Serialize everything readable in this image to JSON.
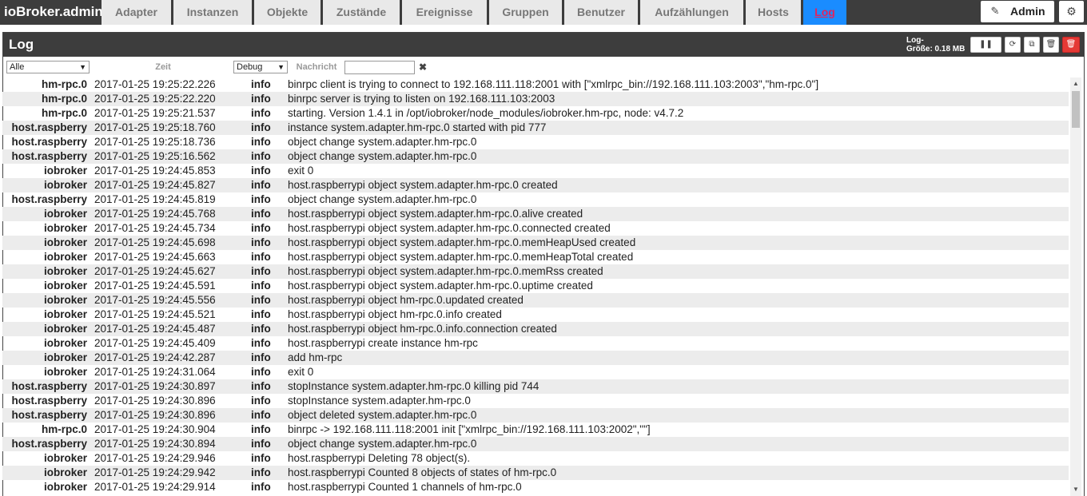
{
  "app": {
    "brand": "ioBroker.admin"
  },
  "nav": {
    "tabs": [
      {
        "label": "Adapter",
        "active": false
      },
      {
        "label": "Instanzen",
        "active": false
      },
      {
        "label": "Objekte",
        "active": false
      },
      {
        "label": "Zustände",
        "active": false
      },
      {
        "label": "Ereignisse",
        "active": false
      },
      {
        "label": "Gruppen",
        "active": false
      },
      {
        "label": "Benutzer",
        "active": false
      },
      {
        "label": "Aufzählungen",
        "active": false
      },
      {
        "label": "Hosts",
        "active": false
      },
      {
        "label": "Log",
        "active": true
      }
    ],
    "admin_label": "Admin",
    "admin_icon": "pencil-icon",
    "settings_icon": "gear-icon"
  },
  "panel": {
    "title": "Log",
    "logsize_label": "Log-",
    "logsize_value": "Größe: 0.18 MB",
    "buttons": [
      {
        "icon": "pause-icon",
        "glyph": "❚❚"
      },
      {
        "icon": "refresh-icon",
        "glyph": "⟳"
      },
      {
        "icon": "copy-icon",
        "glyph": "⧉"
      },
      {
        "icon": "clear-icon",
        "glyph": "🗑"
      },
      {
        "icon": "delete-icon",
        "glyph": "🗑"
      }
    ]
  },
  "filters": {
    "source_value": "Alle",
    "time_label": "Zeit",
    "level_value": "Debug",
    "message_label": "Nachricht",
    "message_value": "",
    "clear_glyph": "✖"
  },
  "log": {
    "rows": [
      {
        "src": "hm-rpc.0",
        "time": "2017-01-25 19:25:22.226",
        "level": "info",
        "msg": "binrpc client is trying to connect to 192.168.111.118:2001 with [\"xmlrpc_bin://192.168.111.103:2003\",\"hm-rpc.0\"]"
      },
      {
        "src": "hm-rpc.0",
        "time": "2017-01-25 19:25:22.220",
        "level": "info",
        "msg": "binrpc server is trying to listen on 192.168.111.103:2003"
      },
      {
        "src": "hm-rpc.0",
        "time": "2017-01-25 19:25:21.537",
        "level": "info",
        "msg": "starting. Version 1.4.1 in /opt/iobroker/node_modules/iobroker.hm-rpc, node: v4.7.2"
      },
      {
        "src": "host.raspberry",
        "time": "2017-01-25 19:25:18.760",
        "level": "info",
        "msg": "instance system.adapter.hm-rpc.0 started with pid 777"
      },
      {
        "src": "host.raspberry",
        "time": "2017-01-25 19:25:18.736",
        "level": "info",
        "msg": "object change system.adapter.hm-rpc.0"
      },
      {
        "src": "host.raspberry",
        "time": "2017-01-25 19:25:16.562",
        "level": "info",
        "msg": "object change system.adapter.hm-rpc.0"
      },
      {
        "src": "iobroker",
        "time": "2017-01-25 19:24:45.853",
        "level": "info",
        "msg": "exit 0"
      },
      {
        "src": "iobroker",
        "time": "2017-01-25 19:24:45.827",
        "level": "info",
        "msg": "host.raspberrypi object system.adapter.hm-rpc.0 created"
      },
      {
        "src": "host.raspberry",
        "time": "2017-01-25 19:24:45.819",
        "level": "info",
        "msg": "object change system.adapter.hm-rpc.0"
      },
      {
        "src": "iobroker",
        "time": "2017-01-25 19:24:45.768",
        "level": "info",
        "msg": "host.raspberrypi object system.adapter.hm-rpc.0.alive created"
      },
      {
        "src": "iobroker",
        "time": "2017-01-25 19:24:45.734",
        "level": "info",
        "msg": "host.raspberrypi object system.adapter.hm-rpc.0.connected created"
      },
      {
        "src": "iobroker",
        "time": "2017-01-25 19:24:45.698",
        "level": "info",
        "msg": "host.raspberrypi object system.adapter.hm-rpc.0.memHeapUsed created"
      },
      {
        "src": "iobroker",
        "time": "2017-01-25 19:24:45.663",
        "level": "info",
        "msg": "host.raspberrypi object system.adapter.hm-rpc.0.memHeapTotal created"
      },
      {
        "src": "iobroker",
        "time": "2017-01-25 19:24:45.627",
        "level": "info",
        "msg": "host.raspberrypi object system.adapter.hm-rpc.0.memRss created"
      },
      {
        "src": "iobroker",
        "time": "2017-01-25 19:24:45.591",
        "level": "info",
        "msg": "host.raspberrypi object system.adapter.hm-rpc.0.uptime created"
      },
      {
        "src": "iobroker",
        "time": "2017-01-25 19:24:45.556",
        "level": "info",
        "msg": "host.raspberrypi object hm-rpc.0.updated created"
      },
      {
        "src": "iobroker",
        "time": "2017-01-25 19:24:45.521",
        "level": "info",
        "msg": "host.raspberrypi object hm-rpc.0.info created"
      },
      {
        "src": "iobroker",
        "time": "2017-01-25 19:24:45.487",
        "level": "info",
        "msg": "host.raspberrypi object hm-rpc.0.info.connection created"
      },
      {
        "src": "iobroker",
        "time": "2017-01-25 19:24:45.409",
        "level": "info",
        "msg": "host.raspberrypi create instance hm-rpc"
      },
      {
        "src": "iobroker",
        "time": "2017-01-25 19:24:42.287",
        "level": "info",
        "msg": "add hm-rpc"
      },
      {
        "src": "iobroker",
        "time": "2017-01-25 19:24:31.064",
        "level": "info",
        "msg": "exit 0"
      },
      {
        "src": "host.raspberry",
        "time": "2017-01-25 19:24:30.897",
        "level": "info",
        "msg": "stopInstance system.adapter.hm-rpc.0 killing pid 744"
      },
      {
        "src": "host.raspberry",
        "time": "2017-01-25 19:24:30.896",
        "level": "info",
        "msg": "stopInstance system.adapter.hm-rpc.0"
      },
      {
        "src": "host.raspberry",
        "time": "2017-01-25 19:24:30.896",
        "level": "info",
        "msg": "object deleted system.adapter.hm-rpc.0"
      },
      {
        "src": "hm-rpc.0",
        "time": "2017-01-25 19:24:30.904",
        "level": "info",
        "msg": "binrpc -> 192.168.111.118:2001 init [\"xmlrpc_bin://192.168.111.103:2002\",\"\"]"
      },
      {
        "src": "host.raspberry",
        "time": "2017-01-25 19:24:30.894",
        "level": "info",
        "msg": "object change system.adapter.hm-rpc.0"
      },
      {
        "src": "iobroker",
        "time": "2017-01-25 19:24:29.946",
        "level": "info",
        "msg": "host.raspberrypi Deleting 78 object(s)."
      },
      {
        "src": "iobroker",
        "time": "2017-01-25 19:24:29.942",
        "level": "info",
        "msg": "host.raspberrypi Counted 8 objects of states of hm-rpc.0"
      },
      {
        "src": "iobroker",
        "time": "2017-01-25 19:24:29.914",
        "level": "info",
        "msg": "host.raspberrypi Counted 1 channels of hm-rpc.0"
      }
    ]
  }
}
